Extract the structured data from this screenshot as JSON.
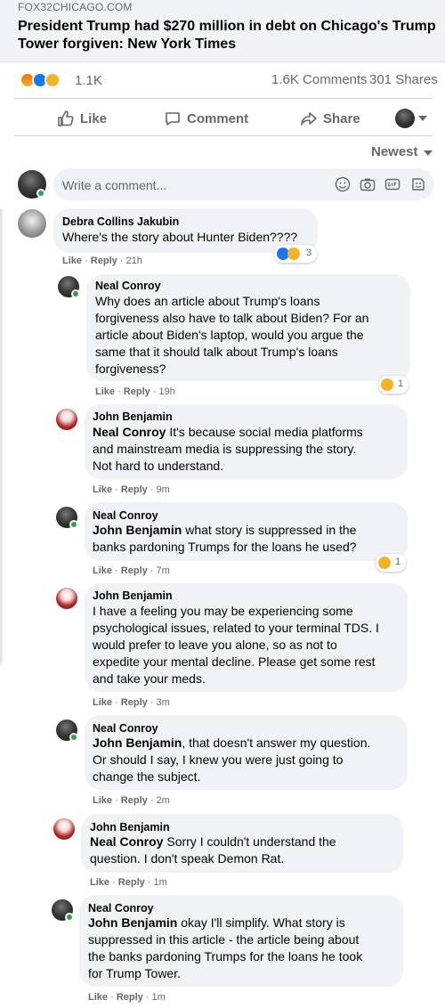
{
  "link_preview": {
    "domain": "FOX32CHICAGO.COM",
    "headline": "President Trump had $270 million in debt on Chicago's Trump Tower forgiven: New York Times"
  },
  "stats": {
    "reactions_count": "1.1K",
    "comments": "1.6K Comments",
    "shares": "301 Shares",
    "reaction_icons": [
      "angry-icon",
      "like-icon",
      "haha-icon"
    ]
  },
  "actions": {
    "like": "Like",
    "comment": "Comment",
    "share": "Share"
  },
  "sort": {
    "label": "Newest"
  },
  "composer": {
    "placeholder": "Write a comment..."
  },
  "comments": [
    {
      "author": "Debra Collins Jakubin",
      "text": "Where's the story about Hunter Biden????",
      "like": "Like",
      "reply": "Reply",
      "time": "21h",
      "reaction_count": "3"
    },
    {
      "author": "Neal Conroy",
      "text_lines": [
        "Why does an article about Trump's loans",
        "forgiveness also have to talk about Biden? For an",
        "article about Biden's laptop, would you argue the",
        "same that it should talk about Trump's loans",
        "forgiveness?"
      ],
      "like": "Like",
      "reply": "Reply",
      "time": "19h",
      "reaction_count": "1"
    },
    {
      "author": "John Benjamin",
      "mention": "Neal Conroy",
      "text_lines": [
        " It's because social media platforms",
        "and mainstream media is suppressing the story.",
        "Not hard to understand."
      ],
      "like": "Like",
      "reply": "Reply",
      "time": "9m"
    },
    {
      "author": "Neal Conroy",
      "mention": "John Benjamin",
      "text_lines": [
        " what story is suppressed in the",
        "banks pardoning Trumps for the loans he used?"
      ],
      "like": "Like",
      "reply": "Reply",
      "time": "7m",
      "reaction_count": "1"
    },
    {
      "author": "John Benjamin",
      "text_lines": [
        "I have a feeling you may be experiencing some",
        "psychological issues, related to your terminal TDS. I",
        "would prefer to leave you alone, so as not to",
        "expedite your mental decline. Please get some rest",
        "and take your meds."
      ],
      "like": "Like",
      "reply": "Reply",
      "time": "3m"
    },
    {
      "author": "Neal Conroy",
      "mention": "John Benjamin",
      "text_lines": [
        ", that doesn't answer my question.",
        "Or should I say, I knew you were just going to",
        "change the subject."
      ],
      "like": "Like",
      "reply": "Reply",
      "time": "2m"
    },
    {
      "author": "John Benjamin",
      "mention": "Neal Conroy",
      "text_lines": [
        " Sorry I couldn't understand the",
        "question. I don't speak Demon Rat."
      ],
      "like": "Like",
      "reply": "Reply",
      "time": "1m"
    },
    {
      "author": "Neal Conroy",
      "mention": "John Benjamin",
      "text_lines": [
        " okay I'll simplify. What story is",
        "suppressed in this article - the article being about",
        "the banks pardoning Trumps for the loans he took",
        "for Trump Tower."
      ],
      "like": "Like",
      "reply": "Reply",
      "time": "1m"
    }
  ],
  "colors": {
    "like_blue": "#1877f2",
    "online_green": "#31a24c",
    "bubble_gray": "#f0f2f5",
    "muted": "#65676b"
  }
}
